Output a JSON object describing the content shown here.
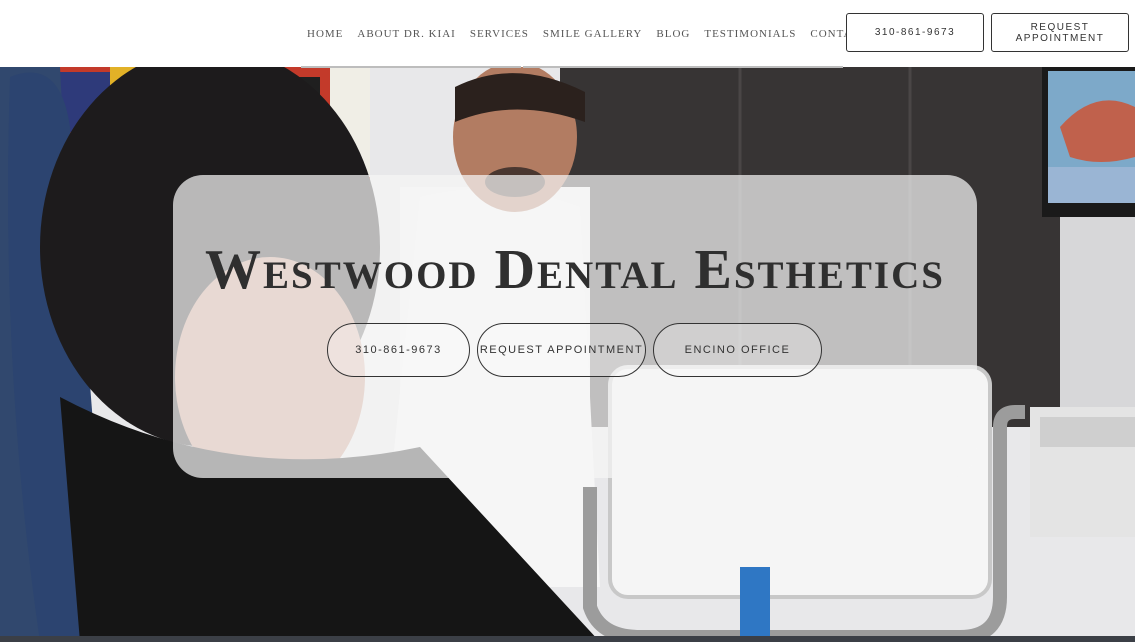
{
  "nav": {
    "items": [
      {
        "label": "Home"
      },
      {
        "label": "About Dr. Kiai"
      },
      {
        "label": "Services"
      },
      {
        "label": "Smile Gallery"
      },
      {
        "label": "Blog"
      },
      {
        "label": "Testimonials"
      },
      {
        "label": "Contact"
      }
    ]
  },
  "header": {
    "phone_label": "310-861-9673",
    "request_label_line1": "REQUEST",
    "request_label_line2": "APPOINTMENT"
  },
  "hero": {
    "title": "Westwood Dental Esthetics",
    "buttons": [
      {
        "label": "310-861-9673"
      },
      {
        "label": "REQUEST APPOINTMENT"
      },
      {
        "label": "ENCINO OFFICE"
      }
    ]
  }
}
